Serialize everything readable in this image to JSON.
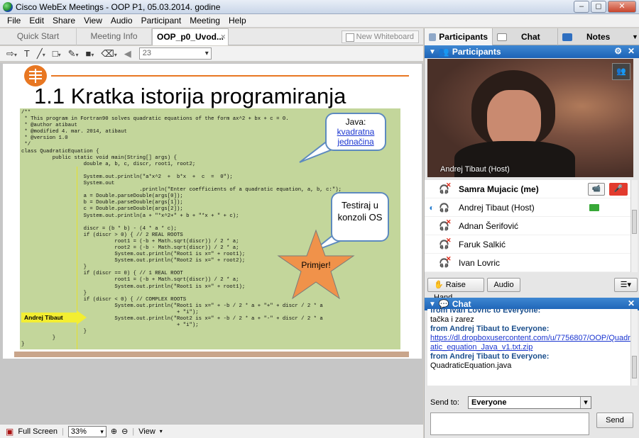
{
  "window": {
    "title": "Cisco WebEx Meetings - OOP P1, 05.03.2014. godine",
    "min": "‒",
    "max": "◻",
    "close": "✕"
  },
  "menu": [
    "File",
    "Edit",
    "Share",
    "View",
    "Audio",
    "Participant",
    "Meeting",
    "Help"
  ],
  "tabs": {
    "quick_start": "Quick Start",
    "meeting_info": "Meeting Info",
    "document": "OOP_p0_Uvod...",
    "close": "✕",
    "new_whiteboard": "New Whiteboard"
  },
  "toolbar": {
    "page_value": "23",
    "prev": "◀"
  },
  "slide": {
    "title": "1.1 Kratka istorija programiranja",
    "code": "/**\n * This program in Fortran90 solves quadratic equations of the form ax^2 + bx + c = 0.\n * @author atibaut\n * @modified 4. mar. 2014, atibaut\n * @version 1.0\n */\nclass QuadraticEquation {\n          public static void main(String[] args) {\n                    double a, b, c, discr, root1, root2;\n\n                    System.out.println(\"a*x^2  +  b*x  +  c  =  0\");\n                    System.out\n                                      .println(\"Enter coefficients of a quadratic equation, a, b, c:\");\n                    a = Double.parseDouble(args[0]);\n                    b = Double.parseDouble(args[1]);\n                    c = Double.parseDouble(args[2]);\n                    System.out.println(a + \"*x^2+\" + b + \"*x + \" + c);\n\n                    discr = (b * b) - (4 * a * c);\n                    if (discr > 0) { // 2 REAL ROOTS\n                              root1 = (-b + Math.sqrt(discr)) / 2 * a;\n                              root2 = (-b - Math.sqrt(discr)) / 2 * a;\n                              System.out.println(\"Root1 is x=\" + root1);\n                              System.out.println(\"Root2 is x=\" + root2);\n                    }\n                    if (discr == 0) { // 1 REAL ROOT\n                              root1 = (-b + Math.sqrt(discr)) / 2 * a;\n                              System.out.println(\"Root1 is x=\" + root1);\n                    }\n                    if (discr < 0) { // COMPLEX ROOTS\n                              System.out.println(\"Root1 is x=\" + -b / 2 * a + \"+\" + discr / 2 * a\n                                                  + \"i\");\n                              System.out.println(\"Root2 is x=\" + -b / 2 * a + \"-\" + discr / 2 * a\n                                                  + \"i\");\n                    }\n          }\n}",
    "callout1": {
      "line1": "Java:",
      "link1": "kvadratna",
      "link2": "jednačina"
    },
    "callout2": "Testiraj u konzoli OS",
    "star_label": "Primjer!",
    "presenter_pointer": "Andrej Tibaut"
  },
  "bottom": {
    "full_screen": "Full Screen",
    "zoom": "33%",
    "view": "View"
  },
  "right": {
    "tabs": {
      "participants": "Participants",
      "chat": "Chat",
      "notes": "Notes"
    },
    "participants_header": "Participants",
    "video_label": "Andrej Tibaut (Host)",
    "participants": [
      {
        "name": "Samra Mujacic (me)",
        "me": true
      },
      {
        "name": "Andrej Tibaut (Host)",
        "me": false
      },
      {
        "name": "Adnan Šerifović",
        "me": false
      },
      {
        "name": "Faruk Salkić",
        "me": false
      },
      {
        "name": "Ivan Lovric",
        "me": false
      }
    ],
    "raise_hand": "Raise Hand",
    "audio": "Audio",
    "chat_header": "Chat",
    "chat": [
      {
        "from": "from Ivan Lovric to Everyone:",
        "msg": "tačka i zarez"
      },
      {
        "from": "from Andrej Tibaut to Everyone:",
        "link": "https://dl.dropboxusercontent.com/u/7756807/OOP/Quadratic_equation_Java_v1.txt.zip"
      },
      {
        "from": "from Andrej Tibaut to Everyone:",
        "msg": "QuadraticEquation.java"
      }
    ],
    "send_to_label": "Send to:",
    "send_to_value": "Everyone",
    "send": "Send"
  },
  "colors": {
    "header_blue": "#1d63b6",
    "slide_code_bg": "#c3d69b",
    "accent_orange": "#e87722",
    "star": "#f0924a"
  }
}
